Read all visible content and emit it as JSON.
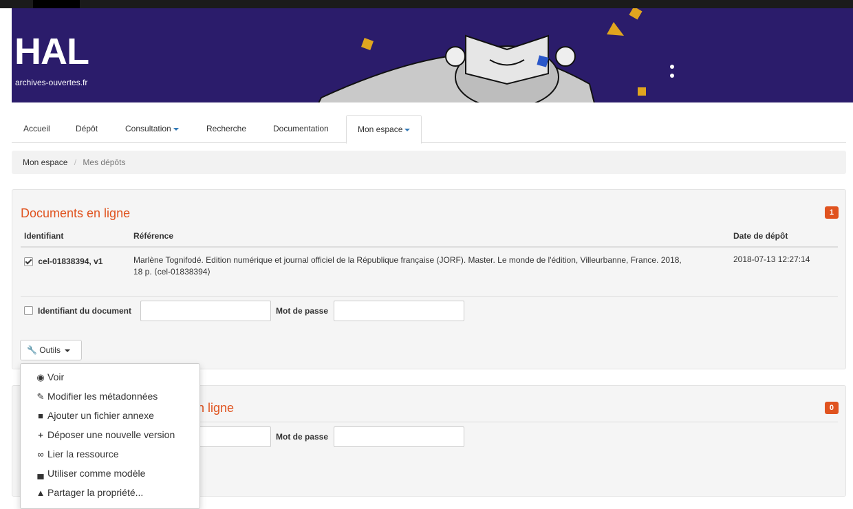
{
  "brand": {
    "logo_text": "HAL",
    "logo_subtitle": "archives-ouvertes.fr"
  },
  "nav": {
    "tabs": [
      {
        "label": "Accueil"
      },
      {
        "label": "Dépôt"
      },
      {
        "label": "Consultation"
      },
      {
        "label": "Recherche"
      },
      {
        "label": "Documentation"
      },
      {
        "label": "Mon espace"
      }
    ]
  },
  "breadcrumb": {
    "home": "Mon espace",
    "separator": "/",
    "current": "Mes dépôts"
  },
  "online": {
    "title": "Documents en ligne",
    "count": "1",
    "columns": {
      "id": "Identifiant",
      "ref": "Référence",
      "date": "Date de dépôt"
    },
    "row": {
      "id": "cel-01838394, v1",
      "ref_line1": "Marlène Tognifodé. Edition numérique et journal officiel de la République française (JORF). Master. Le monde de l'édition, Villeurbanne, France. 2018,",
      "ref_line2": "18 p. ⟨cel-01838394⟩",
      "date": "2018-07-13 12:27:14"
    },
    "form": {
      "id_label": "Identifiant du document",
      "pw_label": "Mot de passe"
    },
    "tools_label": "Outils"
  },
  "offline": {
    "title_visible": "n ligne",
    "count": "0",
    "form": {
      "pw_label": "Mot de passe"
    }
  },
  "tools_menu": {
    "items": [
      {
        "label": "Voir"
      },
      {
        "label": "Modifier les métadonnées"
      },
      {
        "label": "Ajouter un fichier annexe"
      },
      {
        "label": "Déposer une nouvelle version"
      },
      {
        "label": "Lier la ressource"
      },
      {
        "label": "Utiliser comme modèle"
      },
      {
        "label": "Partager la propriété..."
      }
    ]
  },
  "colors": {
    "banner": "#2b1c6b",
    "accent": "#e0531f",
    "link": "#337ab7"
  }
}
